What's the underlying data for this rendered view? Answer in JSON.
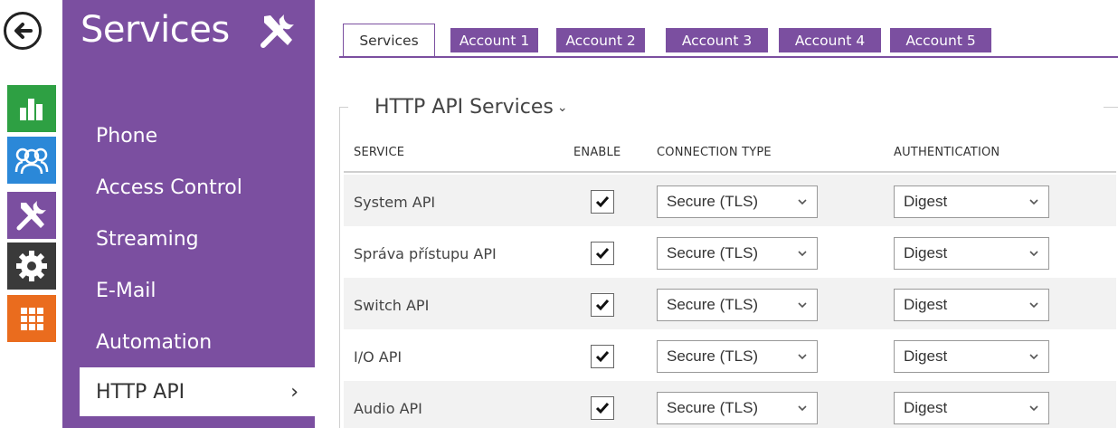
{
  "rail": {
    "back_icon": "back-arrow-icon",
    "items": [
      {
        "icon": "bar-chart-icon",
        "color": "#2ea043"
      },
      {
        "icon": "users-icon",
        "color": "#2b88d8"
      },
      {
        "icon": "tools-icon",
        "color": "#7b4fa0"
      },
      {
        "icon": "gear-icon",
        "color": "#3a3a3a"
      },
      {
        "icon": "grid-icon",
        "color": "#ea6c1e"
      }
    ]
  },
  "menu": {
    "title": "Services",
    "items": [
      "Phone",
      "Access Control",
      "Streaming",
      "E-Mail",
      "Automation"
    ],
    "active": "HTTP API",
    "active_chevron": "›",
    "accent": "#7b4fa0"
  },
  "tabs": [
    "Services",
    "Account 1",
    "Account 2",
    "Account 3",
    "Account 4",
    "Account 5"
  ],
  "section": {
    "title": "HTTP API Services",
    "caret": "⌄"
  },
  "table": {
    "headers": {
      "service": "SERVICE",
      "enable": "ENABLE",
      "connection": "CONNECTION TYPE",
      "auth": "AUTHENTICATION"
    },
    "rows": [
      {
        "service": "System API",
        "enabled": true,
        "connection": "Secure (TLS)",
        "auth": "Digest"
      },
      {
        "service": "Správa přístupu API",
        "enabled": true,
        "connection": "Secure (TLS)",
        "auth": "Digest"
      },
      {
        "service": "Switch API",
        "enabled": true,
        "connection": "Secure (TLS)",
        "auth": "Digest"
      },
      {
        "service": "I/O API",
        "enabled": true,
        "connection": "Secure (TLS)",
        "auth": "Digest"
      },
      {
        "service": "Audio API",
        "enabled": true,
        "connection": "Secure (TLS)",
        "auth": "Digest"
      }
    ]
  }
}
